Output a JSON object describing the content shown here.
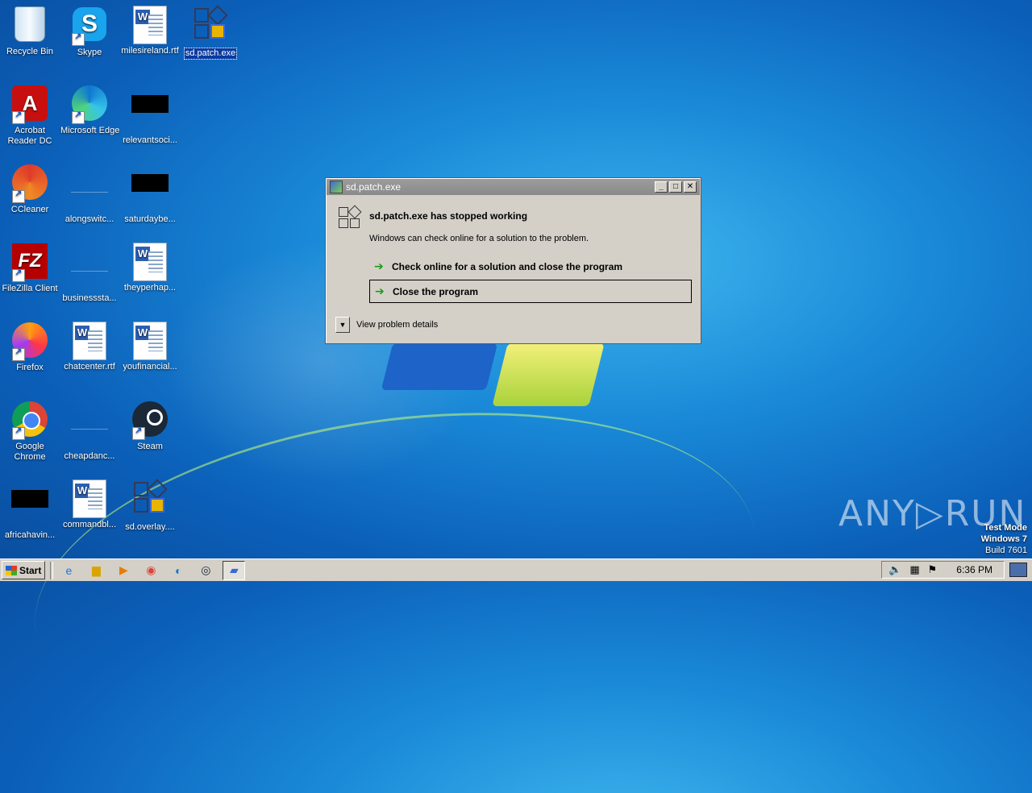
{
  "desktop": {
    "icons": [
      {
        "label": "Recycle Bin"
      },
      {
        "label": "Skype"
      },
      {
        "label": "milesireland.rtf"
      },
      {
        "label": "sd.patch.exe"
      },
      {
        "label": "Acrobat Reader DC"
      },
      {
        "label": "Microsoft Edge"
      },
      {
        "label": "relevantsoci..."
      },
      {
        "label": "CCleaner"
      },
      {
        "label": "alongswitc..."
      },
      {
        "label": "saturdaybe..."
      },
      {
        "label": "FileZilla Client"
      },
      {
        "label": "businesssta..."
      },
      {
        "label": "theyperhap..."
      },
      {
        "label": "Firefox"
      },
      {
        "label": "chatcenter.rtf"
      },
      {
        "label": "youfinancial..."
      },
      {
        "label": "Google Chrome"
      },
      {
        "label": "cheapdanc..."
      },
      {
        "label": "Steam"
      },
      {
        "label": "africahavin..."
      },
      {
        "label": "commandbl..."
      },
      {
        "label": "sd.overlay...."
      }
    ]
  },
  "dialog": {
    "title": "sd.patch.exe",
    "heading": "sd.patch.exe has stopped working",
    "message": "Windows can check online for a solution to the problem.",
    "option_check": "Check online for a solution and close the program",
    "option_close": "Close the program",
    "details": "View problem details",
    "btn_min": "_",
    "btn_max": "□",
    "btn_close": "✕"
  },
  "watermark": "ANY▷RUN",
  "os_badge": {
    "line1": "Test Mode",
    "line2": "Windows 7",
    "line3": "Build 7601"
  },
  "taskbar": {
    "start": "Start",
    "clock": "6:36 PM"
  }
}
